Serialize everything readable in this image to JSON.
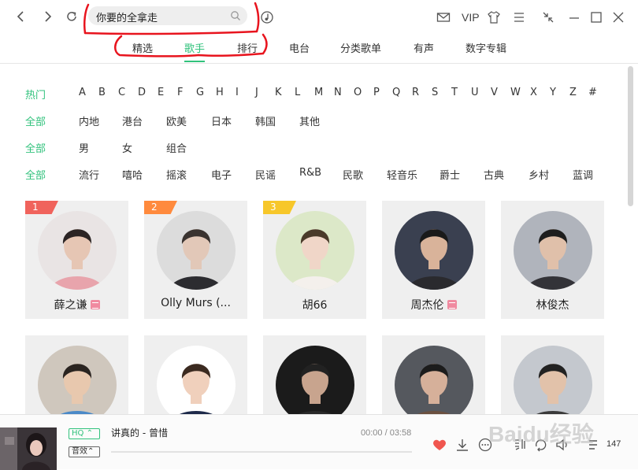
{
  "search": {
    "value": "你要的全拿走"
  },
  "header": {
    "vip_label": "VIP"
  },
  "tabs": [
    {
      "label": "精选"
    },
    {
      "label": "歌手"
    },
    {
      "label": "排行"
    },
    {
      "label": "电台"
    },
    {
      "label": "分类歌单"
    },
    {
      "label": "有声"
    },
    {
      "label": "数字专辑"
    }
  ],
  "active_tab": "歌手",
  "filters": {
    "letters": {
      "label": "热门",
      "items": [
        "A",
        "B",
        "C",
        "D",
        "E",
        "F",
        "G",
        "H",
        "I",
        "J",
        "K",
        "L",
        "M",
        "N",
        "O",
        "P",
        "Q",
        "R",
        "S",
        "T",
        "U",
        "V",
        "W",
        "X",
        "Y",
        "Z",
        "#"
      ]
    },
    "region": {
      "label": "全部",
      "items": [
        "内地",
        "港台",
        "欧美",
        "日本",
        "韩国",
        "其他"
      ]
    },
    "gender": {
      "label": "全部",
      "items": [
        "男",
        "女",
        "组合"
      ]
    },
    "genre": {
      "label": "全部",
      "items": [
        "流行",
        "嘻哈",
        "摇滚",
        "电子",
        "民谣",
        "R&B",
        "民歌",
        "轻音乐",
        "爵士",
        "古典",
        "乡村",
        "蓝调"
      ]
    }
  },
  "singers": [
    {
      "rank": "1",
      "name": "薛之谦",
      "rank_color": "#f0635c",
      "badge": true
    },
    {
      "rank": "2",
      "name": "Olly Murs (...",
      "rank_color": "#ff8a3d",
      "badge": false
    },
    {
      "rank": "3",
      "name": "胡66",
      "rank_color": "#f7c72a",
      "badge": false
    },
    {
      "rank": "",
      "name": "周杰伦",
      "badge": true
    },
    {
      "rank": "",
      "name": "林俊杰",
      "badge": false
    },
    {
      "rank": "",
      "name": "",
      "badge": false
    },
    {
      "rank": "",
      "name": "",
      "badge": false
    },
    {
      "rank": "",
      "name": "",
      "badge": false
    },
    {
      "rank": "",
      "name": "",
      "badge": false
    },
    {
      "rank": "",
      "name": "",
      "badge": false
    }
  ],
  "player": {
    "hq_label": "HQ",
    "sfx_label": "音效",
    "song": "讲真的 - 曾惜",
    "time": "00:00 / 03:58",
    "progress": 0,
    "playlist_count": "147"
  },
  "colors": {
    "accent": "#31c27c",
    "annotation": "#e8141e"
  },
  "icons": [
    "back-icon",
    "forward-icon",
    "refresh-icon",
    "search-icon",
    "music-recognize-icon",
    "mail-icon",
    "skin-icon",
    "menu-icon",
    "mini-mode-icon",
    "maximize-icon",
    "close-icon",
    "heart-icon",
    "download-icon",
    "more-icon",
    "lyrics-icon",
    "loop-icon",
    "volume-icon",
    "playlist-icon"
  ],
  "watermark": "Baidu经验"
}
